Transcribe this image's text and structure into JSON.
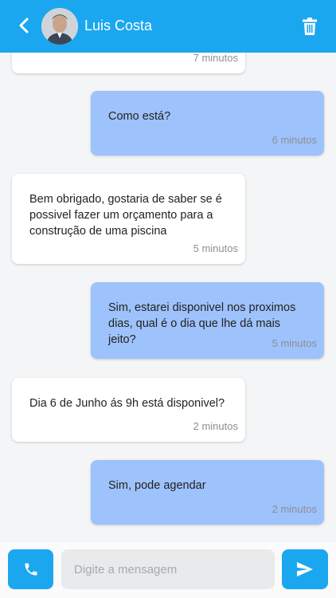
{
  "header": {
    "contact_name": "Luis Costa"
  },
  "messages": [
    {
      "direction": "in",
      "text": "",
      "time": "7 minutos"
    },
    {
      "direction": "out",
      "text": "Como está?",
      "time": "6 minutos"
    },
    {
      "direction": "in",
      "text": "Bem obrigado, gostaria de saber se é possivel fazer um orçamento para a construção de uma piscina",
      "time": "5 minutos"
    },
    {
      "direction": "out",
      "text": "Sim, estarei disponivel nos proximos dias, qual é o dia que lhe dá mais jeito?",
      "time": "5 minutos"
    },
    {
      "direction": "in",
      "text": "Dia 6 de Junho ás 9h está disponivel?",
      "time": "2 minutos"
    },
    {
      "direction": "out",
      "text": "Sim, pode agendar",
      "time": "2 minutos"
    }
  ],
  "composer": {
    "placeholder": "Digite a mensagem"
  },
  "colors": {
    "accent": "#1aa7f0",
    "outgoing_bubble": "#9ec2fb",
    "incoming_bubble": "#ffffff"
  },
  "icons": {
    "back": "chevron-left-icon",
    "delete": "trash-icon",
    "call": "phone-icon",
    "send": "send-icon"
  }
}
